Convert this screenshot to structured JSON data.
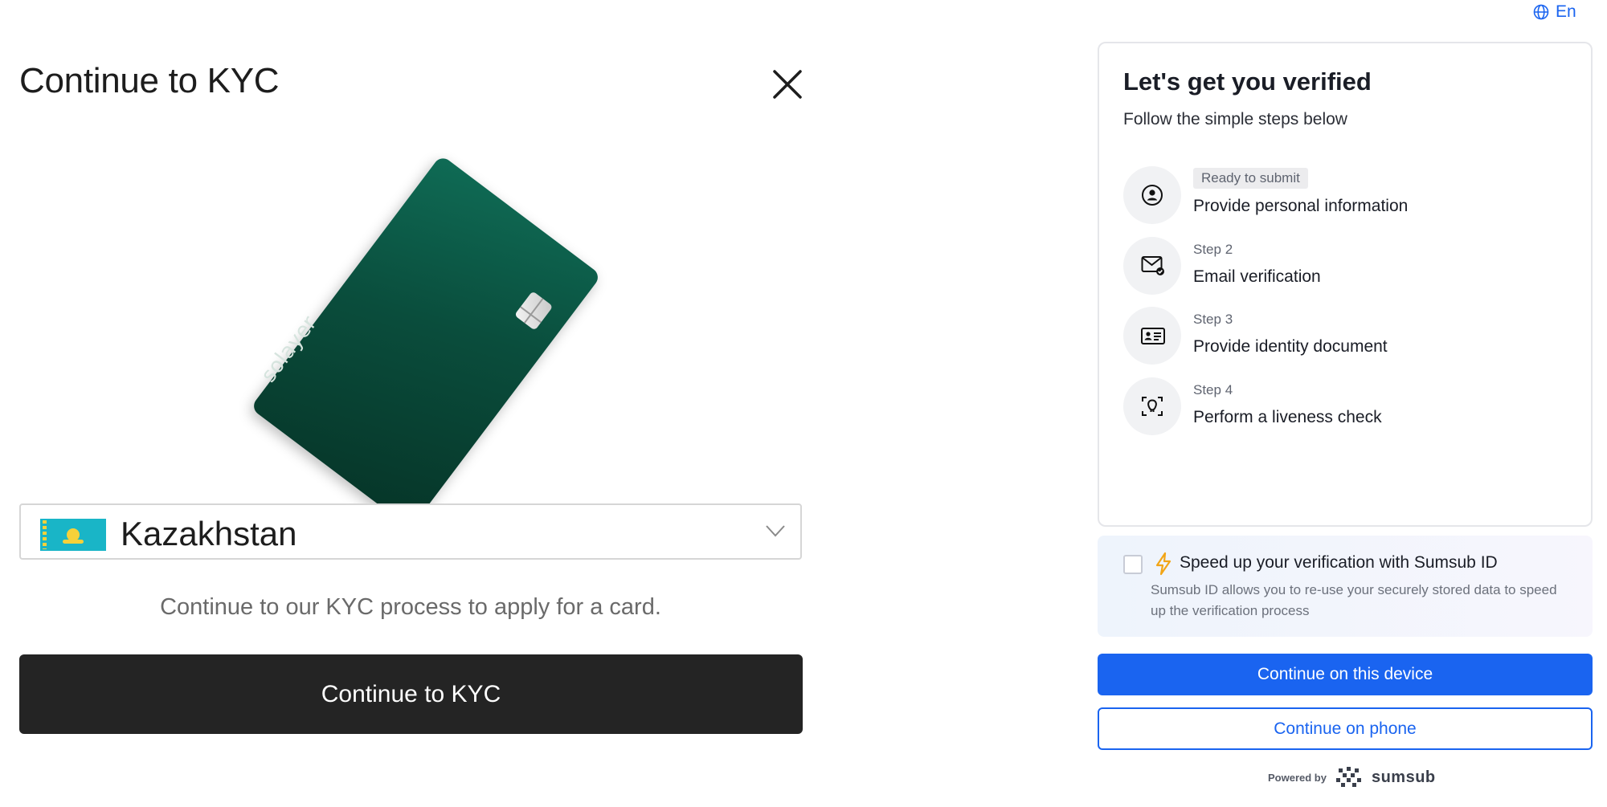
{
  "left_modal": {
    "title": "Continue to KYC",
    "card_brand": "solayer",
    "country": {
      "name": "Kazakhstan",
      "flag": "kazakhstan-flag"
    },
    "description": "Continue to our KYC process to apply for a card.",
    "cta_label": "Continue to KYC"
  },
  "language": {
    "label": "En",
    "icon": "globe-icon"
  },
  "verification": {
    "title": "Let's get you verified",
    "subtitle": "Follow the simple steps below",
    "steps": [
      {
        "tag": "Ready to submit",
        "label": "Provide personal information",
        "icon": "user-circle-icon"
      },
      {
        "tag": "Step 2",
        "label": "Email verification",
        "icon": "mail-check-icon"
      },
      {
        "tag": "Step 3",
        "label": "Provide identity document",
        "icon": "id-card-icon"
      },
      {
        "tag": "Step 4",
        "label": "Perform a liveness check",
        "icon": "face-scan-icon"
      }
    ],
    "sumsub_id": {
      "title": "Speed up your verification with Sumsub ID",
      "description": "Sumsub ID allows you to re-use your securely stored data to speed up the verification process",
      "checked": false
    },
    "primary_button": "Continue on this device",
    "secondary_button": "Continue on phone",
    "powered_by": "Powered by",
    "brand": "sumsub"
  },
  "colors": {
    "primary": "#1a64f0",
    "dark_button": "#242424",
    "card_green": "#0a4d3c"
  }
}
